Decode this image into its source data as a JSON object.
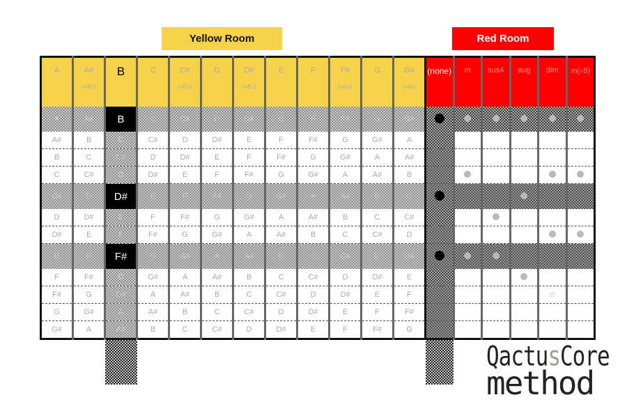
{
  "titles": {
    "yellow_room": "Yellow Room",
    "red_room": "Red Room"
  },
  "colors": {
    "yellow": "#f5d24a",
    "red": "#ff0000",
    "key": "#000000",
    "dot": "#b9b9b9"
  },
  "yellow_room": {
    "headers": [
      {
        "note": "A",
        "alt": ""
      },
      {
        "note": "A#",
        "alt": "(=B♭)"
      },
      {
        "note": "B",
        "alt": ""
      },
      {
        "note": "C",
        "alt": ""
      },
      {
        "note": "C#",
        "alt": "(=D♭)"
      },
      {
        "note": "D",
        "alt": ""
      },
      {
        "note": "D#",
        "alt": "(=E♭)"
      },
      {
        "note": "E",
        "alt": ""
      },
      {
        "note": "F",
        "alt": ""
      },
      {
        "note": "F#",
        "alt": "(=G♭)"
      },
      {
        "note": "G",
        "alt": ""
      },
      {
        "note": "G#",
        "alt": "(=A♭)"
      }
    ],
    "selected_column": 2,
    "highlighted_rows": [
      0,
      4,
      7
    ],
    "rows": [
      [
        "A",
        "A#",
        "B",
        "C",
        "C#",
        "D",
        "D#",
        "E",
        "F",
        "F#",
        "G",
        "G#"
      ],
      [
        "A#",
        "B",
        "C",
        "C#",
        "D",
        "D#",
        "E",
        "F",
        "F#",
        "G",
        "G#",
        "A"
      ],
      [
        "B",
        "C",
        "C#",
        "D",
        "D#",
        "E",
        "F",
        "F#",
        "G",
        "G#",
        "A",
        "A#"
      ],
      [
        "C",
        "C#",
        "D",
        "D#",
        "E",
        "F",
        "F#",
        "G",
        "G#",
        "A",
        "A#",
        "B"
      ],
      [
        "C#",
        "D",
        "D#",
        "E",
        "F",
        "F#",
        "G",
        "G#",
        "A",
        "A#",
        "B",
        "C"
      ],
      [
        "D",
        "D#",
        "E",
        "F",
        "F#",
        "G",
        "G#",
        "A",
        "A#",
        "B",
        "C",
        "C#"
      ],
      [
        "D#",
        "E",
        "F",
        "F#",
        "G",
        "G#",
        "A",
        "A#",
        "B",
        "C",
        "C#",
        "D"
      ],
      [
        "E",
        "F",
        "F#",
        "G",
        "G#",
        "A",
        "A#",
        "B",
        "C",
        "C#",
        "D",
        "D#"
      ],
      [
        "F",
        "F#",
        "G",
        "G#",
        "A",
        "A#",
        "B",
        "C",
        "C#",
        "D",
        "D#",
        "E"
      ],
      [
        "F#",
        "G",
        "G#",
        "A",
        "A#",
        "B",
        "C",
        "C#",
        "D",
        "D#",
        "E",
        "F"
      ],
      [
        "G",
        "G#",
        "A",
        "A#",
        "B",
        "C",
        "C#",
        "D",
        "D#",
        "E",
        "F",
        "F#"
      ],
      [
        "G#",
        "A",
        "A#",
        "B",
        "C",
        "C#",
        "D",
        "D#",
        "E",
        "F",
        "F#",
        "G"
      ]
    ]
  },
  "red_room": {
    "headers": [
      "(none)",
      "m",
      "sus4",
      "aug",
      "dim",
      "m(♭5)"
    ],
    "selected_column": 0,
    "marks": [
      [
        "black",
        "gray",
        "gray",
        "gray",
        "gray",
        "gray"
      ],
      [
        "",
        "",
        "",
        "",
        "",
        ""
      ],
      [
        "",
        "",
        "",
        "",
        "",
        ""
      ],
      [
        "",
        "gray",
        "",
        "",
        "gray",
        "gray"
      ],
      [
        "black",
        "",
        "",
        "gray",
        "",
        ""
      ],
      [
        "",
        "",
        "gray",
        "",
        "",
        ""
      ],
      [
        "",
        "",
        "",
        "",
        "gray",
        "gray"
      ],
      [
        "black",
        "gray",
        "gray",
        "",
        "",
        ""
      ],
      [
        "",
        "",
        "",
        "gray",
        "",
        ""
      ],
      [
        "",
        "",
        "",
        "",
        "star",
        ""
      ],
      [
        "",
        "",
        "",
        "",
        "",
        ""
      ],
      [
        "",
        "",
        "",
        "",
        "",
        ""
      ]
    ]
  },
  "logo": {
    "line1_a": "Qactu",
    "line1_s": "s",
    "line1_b": "Core",
    "line2": "method"
  }
}
